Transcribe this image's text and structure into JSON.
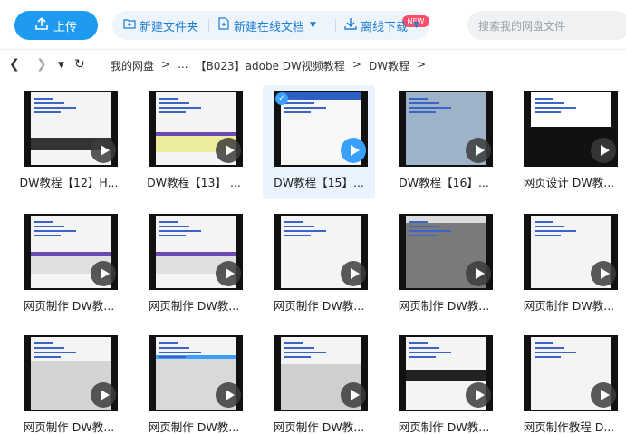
{
  "toolbar": {
    "upload_label": "上传",
    "new_folder_label": "新建文件夹",
    "new_doc_label": "新建在线文档",
    "new_badge": "NEW",
    "offline_download_label": "离线下载",
    "search_placeholder": "搜索我的网盘文件"
  },
  "breadcrumb": {
    "items": [
      "我的网盘",
      ">",
      "...",
      "【B023】adobe DW视频教程",
      ">",
      "DW教程",
      ">"
    ]
  },
  "files": [
    {
      "label": "DW教程【12】H...",
      "selected": false
    },
    {
      "label": "DW教程【13】 ...",
      "selected": false
    },
    {
      "label": "DW教程【15】...",
      "selected": true
    },
    {
      "label": "DW教程【16】...",
      "selected": false
    },
    {
      "label": "网页设计 DW教...",
      "selected": false
    },
    {
      "label": "网页制作 DW教...",
      "selected": false
    },
    {
      "label": "网页制作 DW教...",
      "selected": false
    },
    {
      "label": "网页制作 DW教...",
      "selected": false
    },
    {
      "label": "网页制作 DW教...",
      "selected": false
    },
    {
      "label": "网页制作 DW教...",
      "selected": false
    },
    {
      "label": "网页制作 DW教...",
      "selected": false
    },
    {
      "label": "网页制作 DW教...",
      "selected": false
    },
    {
      "label": "网页制作 DW教...",
      "selected": false
    },
    {
      "label": "网页制作 DW教...",
      "selected": false
    },
    {
      "label": "网页制作教程 D...",
      "selected": false
    }
  ],
  "colors": {
    "accent": "#1e9bf0",
    "action_text": "#1c7ed6",
    "badge": "#ff4d6a"
  }
}
